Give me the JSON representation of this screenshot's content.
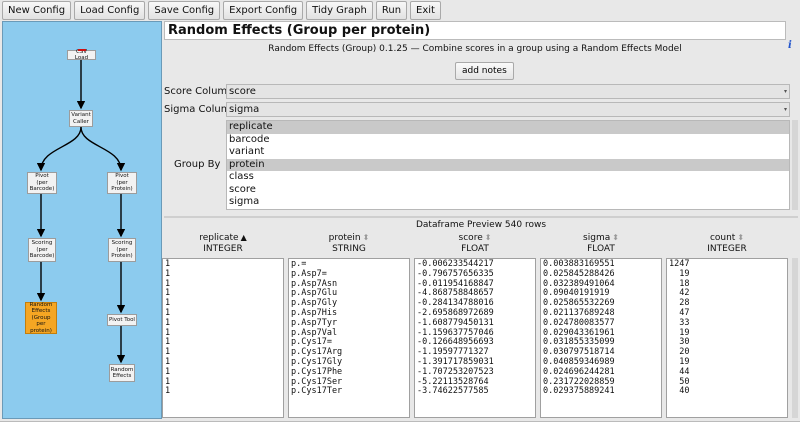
{
  "toolbar": {
    "buttons": [
      "New Config",
      "Load Config",
      "Save Config",
      "Export Config",
      "Tidy Graph",
      "Run",
      "Exit"
    ]
  },
  "graph": {
    "nodes": {
      "csv_load": "CSV Load",
      "variant_caller": "Variant Caller",
      "pivot_barcode": "Pivot (per Barcode)",
      "pivot_protein": "Pivot (per Protein)",
      "scoring_barcode": "Scoring (per Barcode)",
      "scoring_protein": "Scoring (per Protein)",
      "random_effects_group": "Random Effects (Group per protein)",
      "pivot_tool": "Pivot Tool",
      "random_effects": "Random Effects"
    }
  },
  "config": {
    "title": "Random Effects (Group per protein)",
    "description": "Random Effects (Group) 0.1.25 — Combine scores in a group using a Random Effects Model",
    "add_notes_label": "add notes",
    "info_icon": "i",
    "score_column_label": "Score Column",
    "score_column_value": "score",
    "sigma_column_label": "Sigma Column",
    "sigma_column_value": "sigma",
    "group_by_label": "Group By",
    "group_by_items": [
      {
        "label": "replicate",
        "selected": true
      },
      {
        "label": "barcode",
        "selected": false
      },
      {
        "label": "variant",
        "selected": false
      },
      {
        "label": "protein",
        "selected": true
      },
      {
        "label": "class",
        "selected": false
      },
      {
        "label": "score",
        "selected": false
      },
      {
        "label": "sigma",
        "selected": false
      }
    ]
  },
  "preview": {
    "title": "Dataframe Preview 540 rows",
    "columns": [
      {
        "name": "replicate",
        "type": "INTEGER",
        "sorted": true,
        "values": [
          "1",
          "1",
          "1",
          "1",
          "1",
          "1",
          "1",
          "1",
          "1",
          "1",
          "1",
          "1",
          "1",
          "1"
        ]
      },
      {
        "name": "protein",
        "type": "STRING",
        "sorted": false,
        "values": [
          "p.=",
          "p.Asp7=",
          "p.Asp7Asn",
          "p.Asp7Glu",
          "p.Asp7Gly",
          "p.Asp7His",
          "p.Asp7Tyr",
          "p.Asp7Val",
          "p.Cys17=",
          "p.Cys17Arg",
          "p.Cys17Gly",
          "p.Cys17Phe",
          "p.Cys17Ser",
          "p.Cys17Ter"
        ]
      },
      {
        "name": "score",
        "type": "FLOAT",
        "sorted": false,
        "values": [
          "-0.006233544217",
          "-0.796757656335",
          "-0.011954168847",
          "-4.868758848657",
          "-0.284134788016",
          "-2.695868972689",
          "-1.608779450131",
          "-1.159637757046",
          "-0.126648956693",
          "-1.19597771327",
          "-1.391717859031",
          "-1.707253207523",
          "-5.22113528764",
          "-3.74622577585"
        ]
      },
      {
        "name": "sigma",
        "type": "FLOAT",
        "sorted": false,
        "values": [
          "0.003883169551",
          "0.025845288426",
          "0.032389491064",
          "0.09040191919",
          "0.025865532269",
          "0.021137689248",
          "0.024780083577",
          "0.029043361961",
          "0.031855335099",
          "0.030797518714",
          "0.040859346989",
          "0.024696244281",
          "0.231722028859",
          "0.029375889241"
        ]
      },
      {
        "name": "count",
        "type": "INTEGER",
        "sorted": false,
        "values": [
          "1247",
          "  19",
          "  18",
          "  42",
          "  28",
          "  47",
          "  33",
          "  19",
          "  30",
          "  20",
          "  19",
          "  44",
          "  50",
          "  40"
        ]
      }
    ]
  },
  "colors": {
    "graph_bg": "#8ccbee",
    "selected_node": "#f5a623",
    "node_marker": "#d01010"
  }
}
